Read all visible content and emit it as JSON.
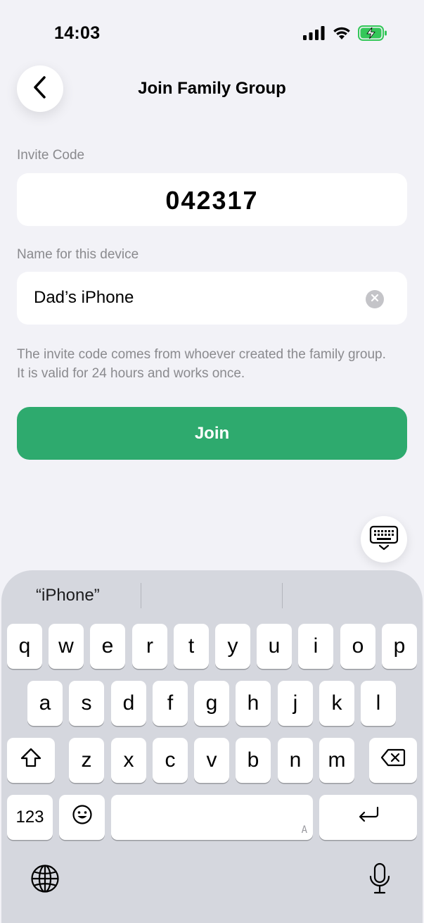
{
  "status_bar": {
    "time": "14:03",
    "icons": [
      "cellular-signal-icon",
      "wifi-icon",
      "battery-charging-icon"
    ]
  },
  "nav": {
    "back_icon": "chevron-left-icon",
    "title": "Join Family Group"
  },
  "form": {
    "invite_code_label": "Invite Code",
    "invite_code_value": "042317",
    "device_name_label": "Name for this device",
    "device_name_value": "Dad’s iPhone",
    "clear_icon": "clear-x-icon",
    "help_text": "The invite code comes from whoever created the family group. It is valid for 24 hours and works once.",
    "join_label": "Join"
  },
  "colors": {
    "background": "#f2f2f7",
    "accent_green": "#2eaa6e",
    "secondary_text": "#8a8a8e",
    "keyboard_bg": "#d5d7de"
  },
  "keyboard": {
    "dismiss_icon": "keyboard-dismiss-icon",
    "suggestions": [
      "“iPhone”",
      "",
      ""
    ],
    "row1": [
      "q",
      "w",
      "e",
      "r",
      "t",
      "y",
      "u",
      "i",
      "o",
      "p"
    ],
    "row2": [
      "a",
      "s",
      "d",
      "f",
      "g",
      "h",
      "j",
      "k",
      "l"
    ],
    "row3": [
      "z",
      "x",
      "c",
      "v",
      "b",
      "n",
      "m"
    ],
    "numbers_label": "123",
    "space_hint": "A",
    "icons": {
      "shift": "shift-icon",
      "delete": "delete-backspace-icon",
      "emoji": "emoji-icon",
      "return": "return-icon",
      "globe": "globe-icon",
      "mic": "microphone-icon"
    }
  }
}
